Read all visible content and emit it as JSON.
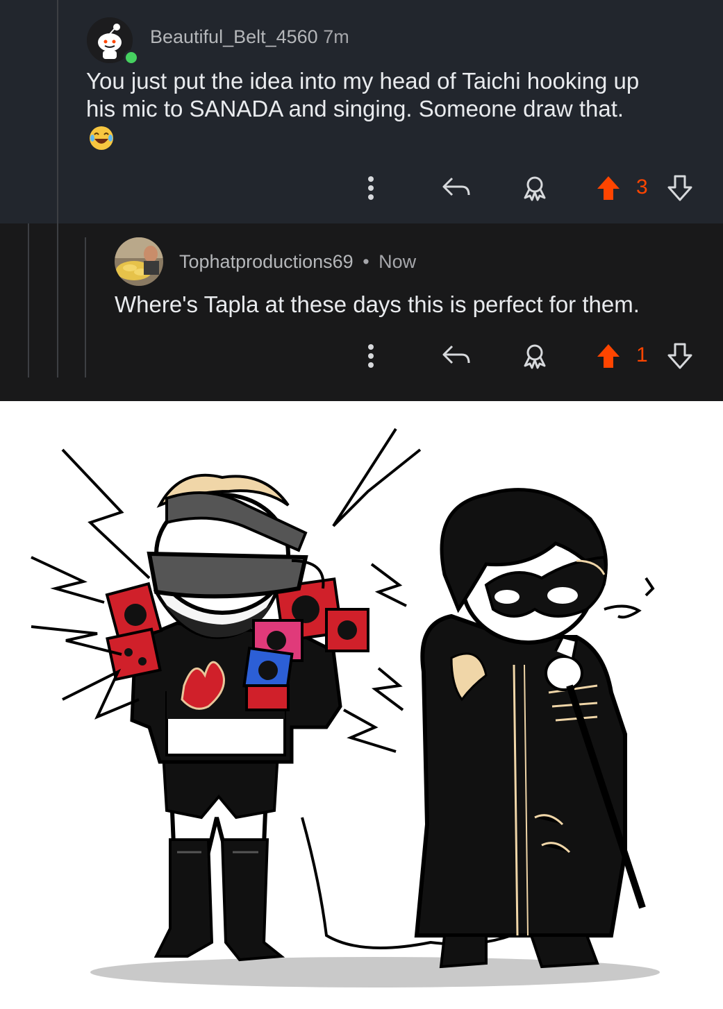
{
  "comments": [
    {
      "username": "Beautiful_Belt_4560",
      "separator": "",
      "time": "7m",
      "body_line1": "You just put the idea into my head of Taichi hooking up",
      "body_line2": "his mic to SANADA and singing. Someone draw that.",
      "emoji": "😂",
      "score": "3"
    },
    {
      "username": "Tophatproductions69",
      "separator": "•",
      "time": "Now",
      "body_line1": "Where's Tapla at these days this is perfect for them.",
      "score": "1"
    }
  ],
  "icons": [
    "avatar-icon",
    "more-options-icon",
    "reply-icon",
    "award-icon",
    "upvote-icon",
    "downvote-icon"
  ],
  "colors": {
    "upvote": "#ff4500",
    "online": "#46d160",
    "background_top": "#22262d",
    "background_reply": "#19191a"
  }
}
